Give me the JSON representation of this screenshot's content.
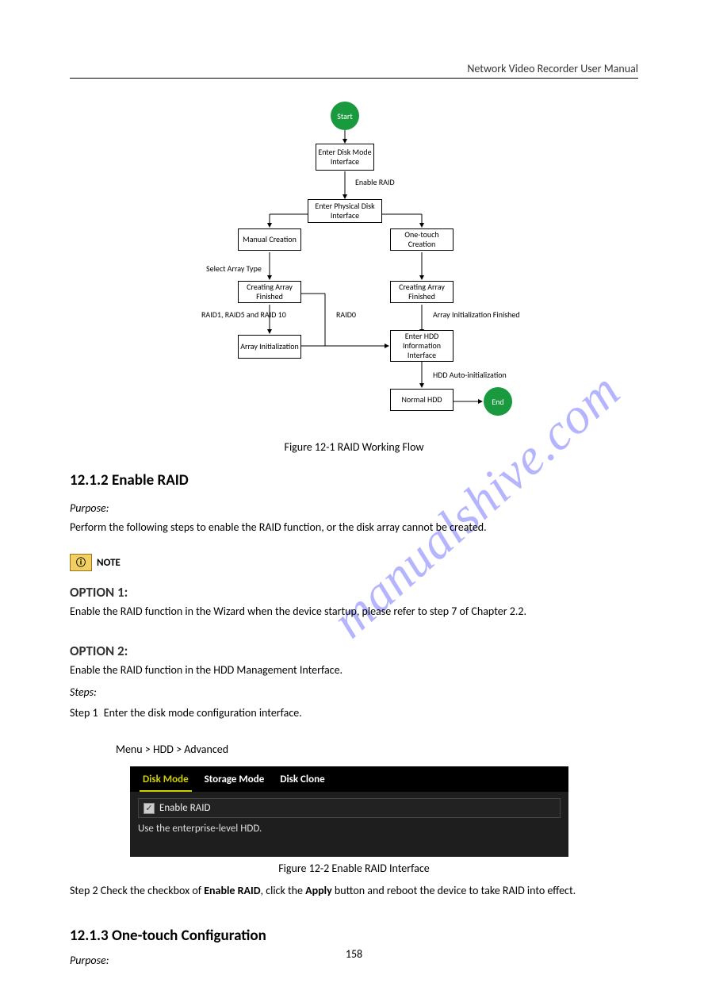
{
  "header": {
    "title": "Network Video Recorder User Manual"
  },
  "flow": {
    "start": "Start",
    "enter_disk_mode": "Enter Disk Mode Interface",
    "enable_raid": "Enable RAID",
    "enter_phys": "Enter Physical Disk Interface",
    "manual": "Manual Creation",
    "onetouch": "One-touch Creation",
    "select_type": "Select Array Type",
    "cfin_l": "Creating Array Finished",
    "cfin_r": "Creating Array Finished",
    "raid_note": "RAID1, RAID5 and RAID 10",
    "raid0": "RAID0",
    "init_fin": "Array Initialization Finished",
    "ainit": "Array Initialization",
    "ehdd": "Enter HDD Information Interface",
    "autoinit": "HDD Auto-initialization",
    "normal": "Normal HDD",
    "end": "End",
    "caption": "Figure 12-1 RAID Working Flow"
  },
  "sec1": {
    "title": "12.1.2 Enable RAID",
    "purpose_lbl": "Purpose:",
    "purpose": "Perform the following steps to enable the RAID function, or the disk array cannot be created.",
    "opt1_h": "OPTION 1:",
    "opt1": "Enable the RAID function in the Wizard when the device startup, please refer to step 7 of Chapter 2.2.",
    "opt2_h": "OPTION 2:",
    "opt2": "Enable the RAID function in the HDD Management Interface.",
    "steps_lbl": "Steps:",
    "step1_lbl": "Step 1",
    "step1": "Enter the disk mode configuration interface.",
    "step1_path": "Menu > HDD > Advanced"
  },
  "panel": {
    "tabs": {
      "t1": "Disk Mode",
      "t2": "Storage Mode",
      "t3": "Disk Clone"
    },
    "enable_raid": "Enable RAID",
    "hint": "Use the enterprise-level HDD.",
    "caption": "Figure 12-2 Enable RAID Interface"
  },
  "post": {
    "step2_lbl": "Step 2",
    "step2": "Check the checkbox of ",
    "step2_b": "Enable RAID",
    "step2_c": ", click the ",
    "step2_bb": "Apply",
    "step2_cc": " button and reboot the device to take RAID into effect."
  },
  "sec2": {
    "title": "12.1.3 One-touch Configuration",
    "purpose_lbl": "Purpose:"
  },
  "watermark": "manualshive.com",
  "footer": "158"
}
